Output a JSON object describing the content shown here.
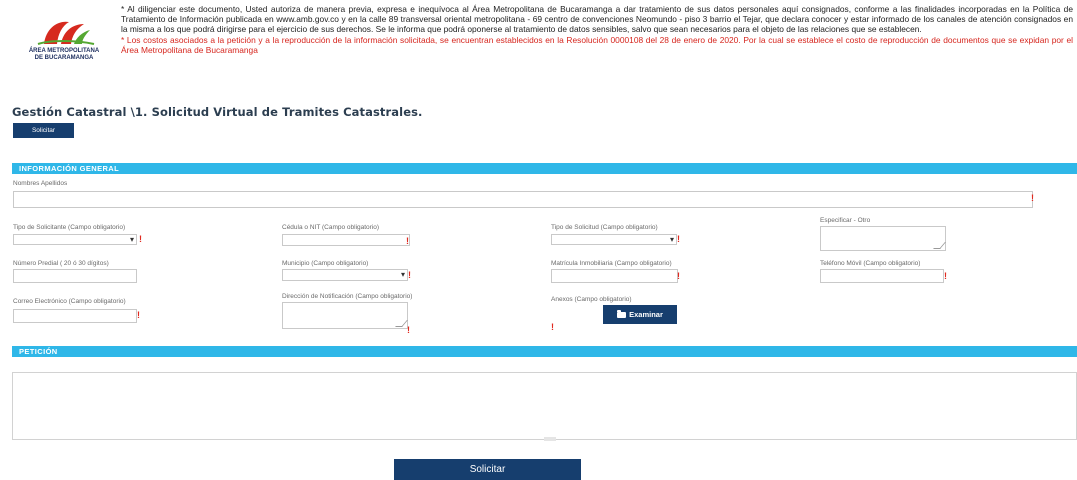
{
  "logo": {
    "line1": "ÁREA METROPOLITANA",
    "line2": "DE BUCARAMANGA",
    "colors": {
      "red": "#d62a1f",
      "green": "#55a832",
      "navy": "#1c2d5e"
    }
  },
  "notice": {
    "p1_start": "* Al diligenciar este documento, Usted autoriza de manera previa, expresa e inequívoca al Área Metropolitana de Bucaramanga a dar tratamiento de sus datos personales aquí consignados, conforme a las finalidades incorporadas en la Política de Tratamiento de Información publicada en www.amb.gov.co y en la calle 89 transversal oriental metropolitana - 69 centro de convenciones Neomundo - piso 3 barrio el Tejar, que declara conocer y estar informado de los canales de atención consignados en la misma a los que podrá dirigirse para el ejercicio de sus derechos. Se le informa que podrá oponerse al tratamiento de datos sensibles, salvo que sean necesarios para el objeto de las relaciones que se establecen.",
    "p2": "* Los costos asociados a la petición y a la reproducción de la información solicitada, se encuentran establecidos en la Resolución 0000108 del 28 de enero de 2020. Por la cual se establece el costo de reproducción de documentos que se expidan por el Área Metropolitana de Bucaramanga"
  },
  "page_title": "Gestión Catastral \\1. Solicitud Virtual de Tramites Catastrales.",
  "top_button": "Solicitar",
  "section_general": "INFORMACIÓN GENERAL",
  "section_petition": "PETICIÓN",
  "fields": {
    "nombres": "Nombres Apellidos",
    "tipo_solicitante": "Tipo de Solicitante (Campo obligatorio)",
    "cedula": "Cédula o NIT (Campo obligatorio)",
    "tipo_solicitud": "Tipo de Solicitud (Campo obligatorio)",
    "especificar": "Especificar - Otro",
    "numero_predial": "Número Predial ( 20 ó 30 dígitos)",
    "municipio": "Municipio (Campo obligatorio)",
    "matricula": "Matrícula Inmobiliaria (Campo obligatorio)",
    "telefono": "Teléfono Móvil (Campo obligatorio)",
    "correo": "Correo Electrónico (Campo obligatorio)",
    "direccion": "Dirección de Notificación (Campo obligatorio)",
    "anexos": "Anexos (Campo obligatorio)"
  },
  "required_mark": "!",
  "caret": "▾",
  "browse_button": "Examinar",
  "bottom_button": "Solicitar",
  "colors": {
    "section_bar": "#2fb7e8",
    "button": "#163e6e",
    "required": "#e02a20",
    "notice_red": "#d6261e"
  }
}
